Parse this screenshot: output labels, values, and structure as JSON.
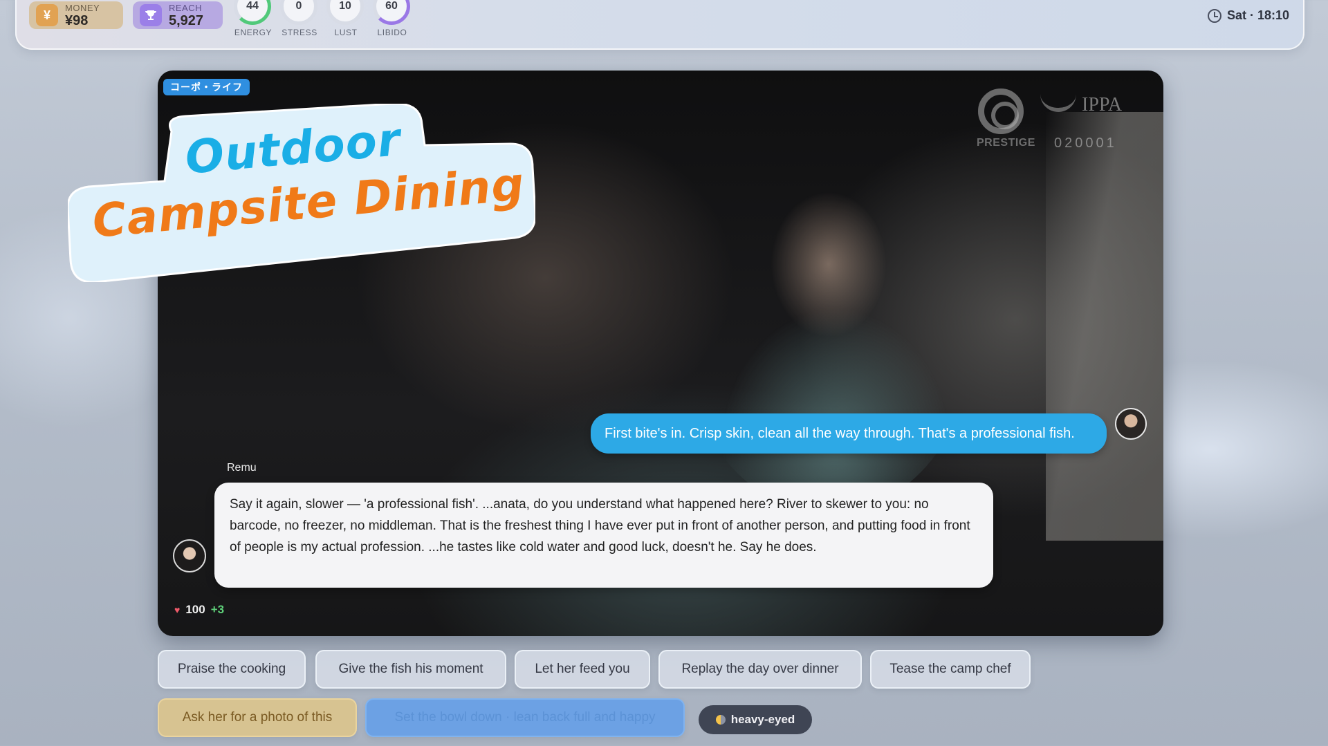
{
  "header": {
    "money": {
      "label": "MONEY",
      "value": "¥98",
      "icon": "yen-icon"
    },
    "reach": {
      "label": "REACH",
      "value": "5,927",
      "icon": "trophy-icon"
    },
    "gauges": [
      {
        "label": "ENERGY",
        "value": "44"
      },
      {
        "label": "STRESS",
        "value": "0"
      },
      {
        "label": "LUST",
        "value": "10"
      },
      {
        "label": "LIBIDO",
        "value": "60"
      }
    ],
    "clock": "Sat · 18:10"
  },
  "scene": {
    "category_tag": "コーポ・ライフ",
    "title_line1": "Outdoor",
    "title_line2": "Campsite Dining",
    "watermark": {
      "brand_left": "PRESTIGE",
      "brand_right": "IPPA",
      "code": "020001"
    }
  },
  "chat": {
    "player_message": "First bite's in. Crisp skin, clean all the way through. That's a professional fish.",
    "speaker_name": "Remu",
    "npc_message": "Say it again, slower — 'a professional fish'. ...anata, do you understand what happened here? River to skewer to you: no barcode, no freezer, no middleman. That is the freshest thing I have ever put in front of another person, and putting food in front of people is my actual profession. ...he tastes like cold water and good luck, doesn't he. Say he does.",
    "affinity": {
      "value": "100",
      "delta": "+3"
    }
  },
  "choices": [
    "Praise the cooking",
    "Give the fish his moment",
    "Let her feed you",
    "Replay the day over dinner",
    "Tease the camp chef"
  ],
  "special_choices": {
    "photo": "Ask her for a photo of this",
    "rest": "Set the bowl down · lean back full and happy"
  },
  "mood": "heavy-eyed",
  "colors": {
    "accent_blue": "#2da9e6",
    "title_orange": "#f07a18",
    "title_blue": "#1aaee6",
    "affinity_green": "#5fd17a",
    "heart": "#f05a6a"
  }
}
